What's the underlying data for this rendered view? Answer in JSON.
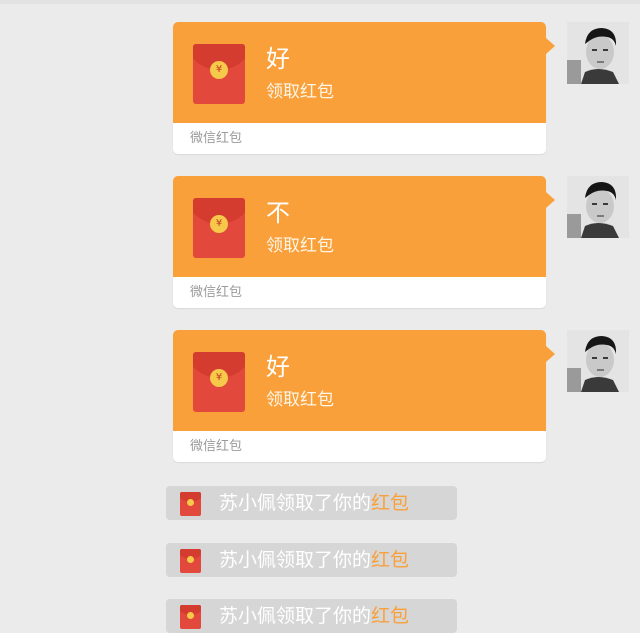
{
  "messages": [
    {
      "greeting": "好",
      "subtitle": "领取红包",
      "footer": "微信红包"
    },
    {
      "greeting": "不",
      "subtitle": "领取红包",
      "footer": "微信红包"
    },
    {
      "greeting": "好",
      "subtitle": "领取红包",
      "footer": "微信红包"
    }
  ],
  "notices": [
    {
      "text": "苏小佩领取了你的",
      "link": "红包"
    },
    {
      "text": "苏小佩领取了你的",
      "link": "红包"
    },
    {
      "text": "苏小佩领取了你的",
      "link": "红包"
    }
  ],
  "icons": {
    "packet": "red-packet-icon",
    "coin": "yuan-coin-icon",
    "coin_symbol": "¥",
    "avatar": "user-avatar"
  },
  "colors": {
    "bubble_orange": "#f9a03a",
    "packet_red": "#e2483b",
    "coin_gold": "#f7c94b",
    "notice_gray": "#d6d6d6",
    "background": "#ebebeb"
  }
}
